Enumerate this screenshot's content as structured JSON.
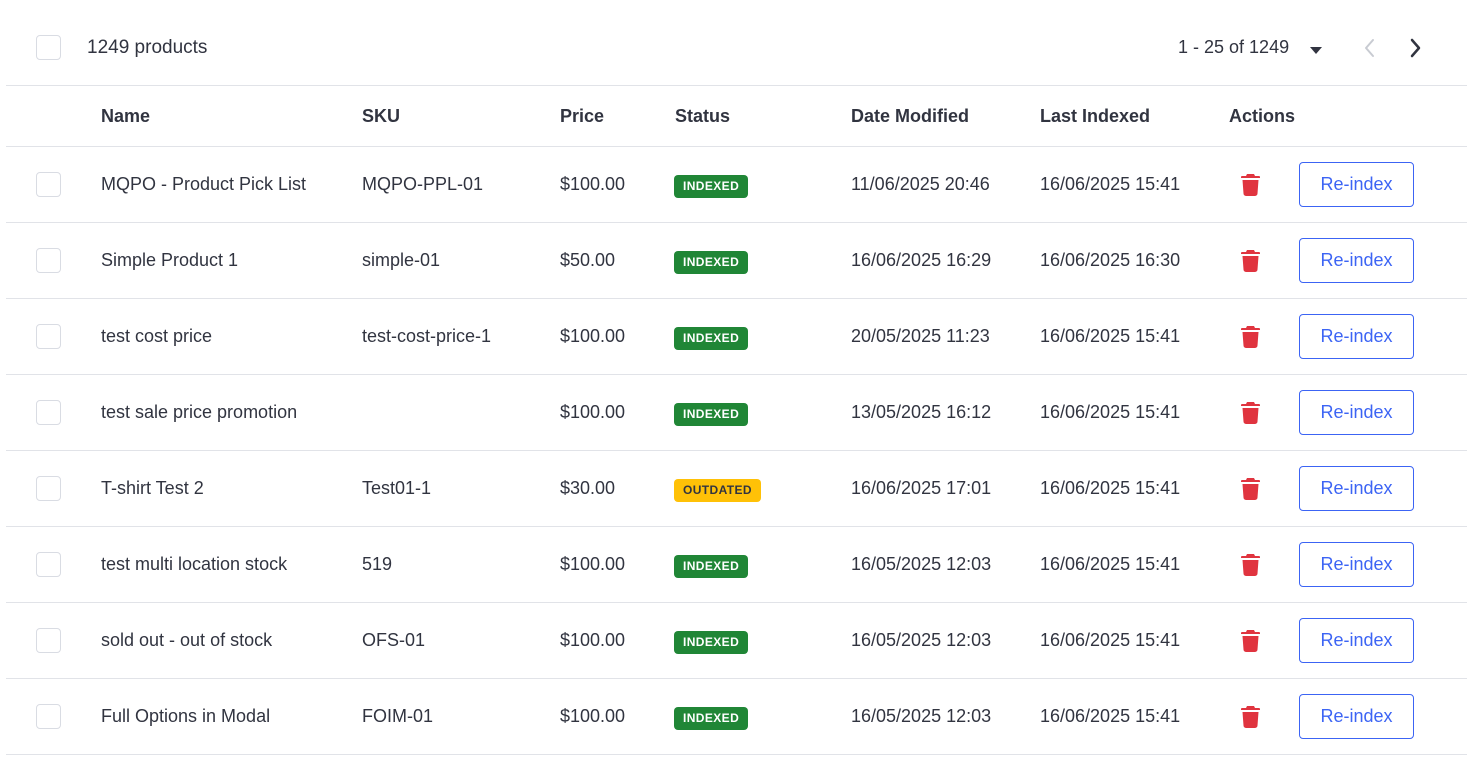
{
  "toolbar": {
    "count_label": "1249 products",
    "pagination_label": "1 - 25 of 1249"
  },
  "table": {
    "headers": {
      "name": "Name",
      "sku": "SKU",
      "price": "Price",
      "status": "Status",
      "date_modified": "Date Modified",
      "last_indexed": "Last Indexed",
      "actions": "Actions"
    },
    "rows": [
      {
        "name": "MQPO - Product Pick List",
        "sku": "MQPO-PPL-01",
        "price": "$100.00",
        "status": "INDEXED",
        "date_modified": "11/06/2025 20:46",
        "last_indexed": "16/06/2025 15:41",
        "action": "Re-index"
      },
      {
        "name": "Simple Product 1",
        "sku": "simple-01",
        "price": "$50.00",
        "status": "INDEXED",
        "date_modified": "16/06/2025 16:29",
        "last_indexed": "16/06/2025 16:30",
        "action": "Re-index"
      },
      {
        "name": "test cost price",
        "sku": "test-cost-price-1",
        "price": "$100.00",
        "status": "INDEXED",
        "date_modified": "20/05/2025 11:23",
        "last_indexed": "16/06/2025 15:41",
        "action": "Re-index"
      },
      {
        "name": "test sale price promotion",
        "sku": "",
        "price": "$100.00",
        "status": "INDEXED",
        "date_modified": "13/05/2025 16:12",
        "last_indexed": "16/06/2025 15:41",
        "action": "Re-index"
      },
      {
        "name": "T-shirt Test 2",
        "sku": "Test01-1",
        "price": "$30.00",
        "status": "OUTDATED",
        "date_modified": "16/06/2025 17:01",
        "last_indexed": "16/06/2025 15:41",
        "action": "Re-index"
      },
      {
        "name": "test multi location stock",
        "sku": "519",
        "price": "$100.00",
        "status": "INDEXED",
        "date_modified": "16/05/2025 12:03",
        "last_indexed": "16/06/2025 15:41",
        "action": "Re-index"
      },
      {
        "name": "sold out - out of stock",
        "sku": "OFS-01",
        "price": "$100.00",
        "status": "INDEXED",
        "date_modified": "16/05/2025 12:03",
        "last_indexed": "16/06/2025 15:41",
        "action": "Re-index"
      },
      {
        "name": "Full Options in Modal",
        "sku": "FOIM-01",
        "price": "$100.00",
        "status": "INDEXED",
        "date_modified": "16/05/2025 12:03",
        "last_indexed": "16/06/2025 15:41",
        "action": "Re-index"
      }
    ]
  },
  "icons": {
    "delete": "trash-icon",
    "page_size": "caret-down-icon",
    "previous": "chevron-left-icon",
    "next": "chevron-right-icon"
  },
  "colors": {
    "indexed_badge": "#208636",
    "outdated_badge": "#ffc107",
    "delete_icon": "#e0343f",
    "reindex_button": "#3c64f4",
    "divider": "#e1e3e8"
  }
}
